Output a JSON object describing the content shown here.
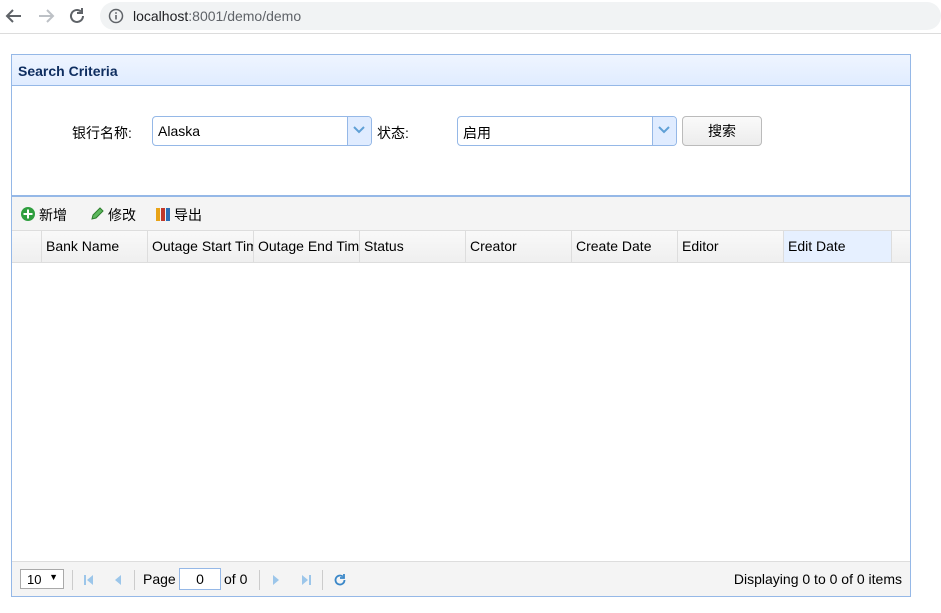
{
  "browser": {
    "url_host": "localhost",
    "url_rest": ":8001/demo/demo"
  },
  "search": {
    "title": "Search Criteria",
    "bank_label": "银行名称:",
    "bank_value": "Alaska",
    "status_label": "状态:",
    "status_value": "启用",
    "search_button": "搜索"
  },
  "toolbar": {
    "add": "新增",
    "edit": "修改",
    "export": "导出"
  },
  "grid": {
    "columns": [
      "Bank Name",
      "Outage Start Time",
      "Outage End Time",
      "Status",
      "Creator",
      "Create Date",
      "Editor",
      "Edit Date"
    ]
  },
  "pager": {
    "page_size": "10",
    "page_label": "Page",
    "page_value": "0",
    "of_label": "of 0",
    "display": "Displaying 0 to 0 of 0 items"
  },
  "colors": {
    "panel_border": "#95b8e7",
    "header_title": "#0e2d5f",
    "pager_icon": "#66aadd"
  }
}
